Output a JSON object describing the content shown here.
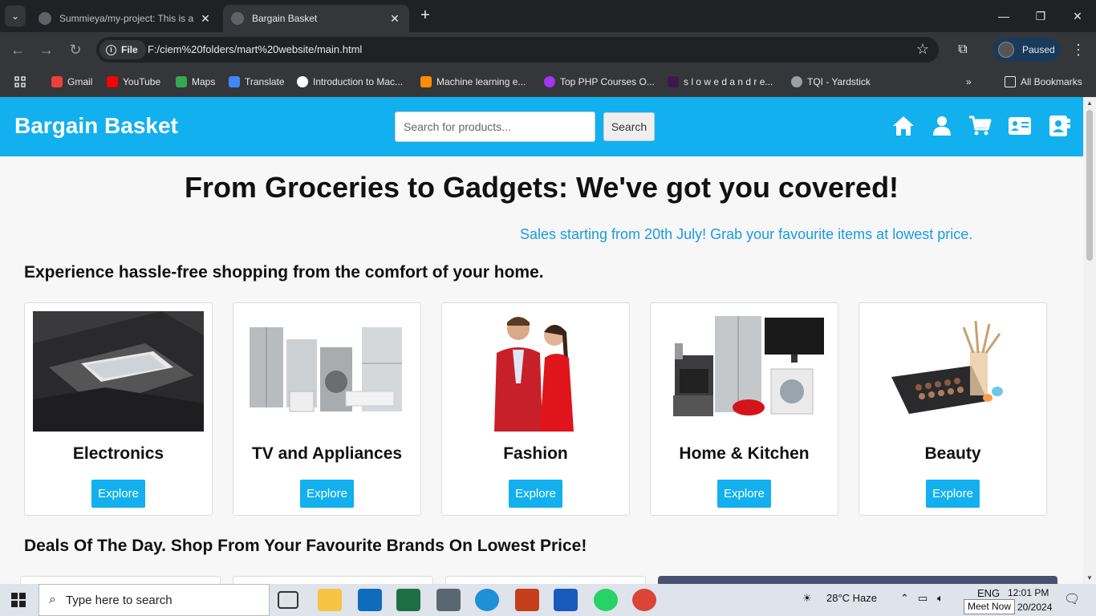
{
  "browser": {
    "tabs": [
      {
        "title": "Summieya/my-project: This is a",
        "active": false
      },
      {
        "title": "Bargain Basket",
        "active": true
      }
    ],
    "url_chip": "File",
    "url": "F:/ciem%20folders/mart%20website/main.html",
    "profile_status": "Paused",
    "bookmarks": [
      {
        "label": "Gmail",
        "icon": "gmail-icon",
        "color": "#ea4335"
      },
      {
        "label": "YouTube",
        "icon": "youtube-icon",
        "color": "#ff0000"
      },
      {
        "label": "Maps",
        "icon": "maps-icon",
        "color": "#34a853"
      },
      {
        "label": "Translate",
        "icon": "translate-icon",
        "color": "#4285f4"
      },
      {
        "label": "Introduction to Mac...",
        "icon": "google-icon",
        "color": "#ffffff"
      },
      {
        "label": "Machine learning e...",
        "icon": "tensorflow-icon",
        "color": "#ff8f00"
      },
      {
        "label": "Top PHP Courses O...",
        "icon": "udemy-icon",
        "color": "#a435f0"
      },
      {
        "label": "s l o w e d a n d r e...",
        "icon": "music-icon",
        "color": "#3b1a4a"
      },
      {
        "label": "TQI - Yardstick",
        "icon": "globe-icon",
        "color": "#9aa0a6"
      }
    ],
    "all_bookmarks_label": "All Bookmarks"
  },
  "site": {
    "brand": "Bargain Basket",
    "search": {
      "placeholder": "Search for products...",
      "button_label": "Search"
    },
    "header_icons": [
      "home-icon",
      "user-icon",
      "cart-icon",
      "contact-card-icon",
      "address-book-icon"
    ],
    "accent_color": "#12b0ee",
    "hero_title": "From Groceries to Gadgets: We've got you covered!",
    "marquee": "Sales starting from 20th July! Grab your favourite items at lowest price.",
    "subtitle": "Experience hassle-free shopping from the comfort of your home.",
    "categories": [
      {
        "name": "Electronics",
        "button": "Explore"
      },
      {
        "name": "TV and Appliances",
        "button": "Explore"
      },
      {
        "name": "Fashion",
        "button": "Explore"
      },
      {
        "name": "Home & Kitchen",
        "button": "Explore"
      },
      {
        "name": "Beauty",
        "button": "Explore"
      }
    ],
    "deals_title": "Deals Of The Day. Shop From Your Favourite Brands On Lowest Price!"
  },
  "taskbar": {
    "search_placeholder": "Type here to search",
    "weather": "28°C  Haze",
    "language": "ENG",
    "time": "12:01 PM",
    "date": "20/2024",
    "tooltip": "Meet Now"
  }
}
